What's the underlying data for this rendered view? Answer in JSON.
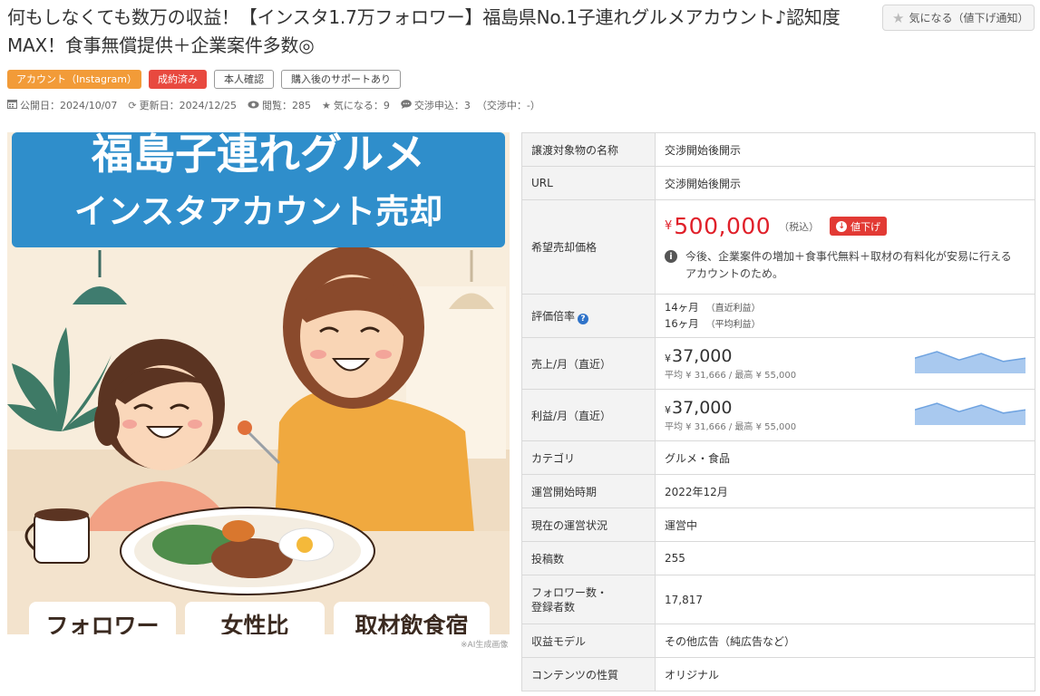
{
  "title": "何もしなくても数万の収益！【インスタ1.7万フォロワー】福島県No.1子連れグルメアカウント♪認知度MAX！食事無償提供＋企業案件多数◎",
  "favorite_button": {
    "label": "気になる（値下げ通知）",
    "icon": "star-icon"
  },
  "tags": {
    "category": "アカウント（Instagram）",
    "status": "成約済み",
    "verified": "本人確認",
    "support": "購入後のサポートあり"
  },
  "meta": {
    "published": "公開日：2024/10/07",
    "updated": "更新日：2024/12/25",
    "views": "閲覧：285",
    "favorites": "気になる：9",
    "negotiations": "交渉申込：3",
    "in_negotiation": "（交渉中：-）"
  },
  "hero": {
    "headline_line1": "福島子連れグルメ",
    "headline_line2": "インスタアカウント売却",
    "card1": "フォロワー",
    "card2": "女性比",
    "card3": "取材飲食宿",
    "ai_note": "※AI生成画像",
    "colors": {
      "banner": "#2f8ecb",
      "background": "#f7ecdc",
      "mother_shirt": "#f0a93f",
      "child_shirt": "#f2a184"
    }
  },
  "spec": {
    "target_name": {
      "key": "譲渡対象物の名称",
      "value": "交渉開始後開示"
    },
    "url": {
      "key": "URL",
      "value": "交渉開始後開示"
    },
    "price": {
      "key": "希望売却価格",
      "yen": "¥",
      "value": "500,000",
      "tax": "（税込）",
      "badge": "値下げ",
      "note": "今後、企業案件の増加＋食事代無料＋取材の有料化が安易に行えるアカウントのため。"
    },
    "multiple": {
      "key": "評価倍率",
      "recent_value": "14ヶ月",
      "recent_label": "（直近利益）",
      "avg_value": "16ヶ月",
      "avg_label": "（平均利益）"
    },
    "sales": {
      "key": "売上/月（直近）",
      "yen": "¥",
      "value": "37,000",
      "sub": "平均 ¥ 31,666 / 最高 ¥ 55,000",
      "trend": [
        37000,
        55000,
        32000,
        50000,
        28000,
        37000
      ]
    },
    "profit": {
      "key": "利益/月（直近）",
      "yen": "¥",
      "value": "37,000",
      "sub": "平均 ¥ 31,666 / 最高 ¥ 55,000",
      "trend": [
        37000,
        55000,
        32000,
        50000,
        28000,
        37000
      ]
    },
    "category": {
      "key": "カテゴリ",
      "value": "グルメ・食品"
    },
    "start": {
      "key": "運営開始時期",
      "value": "2022年12月"
    },
    "status": {
      "key": "現在の運営状況",
      "value": "運営中"
    },
    "posts": {
      "key": "投稿数",
      "value": "255"
    },
    "followers": {
      "key_line1": "フォロワー数・",
      "key_line2": "登録者数",
      "value": "17,817"
    },
    "revenue_model": {
      "key": "収益モデル",
      "value": "その他広告（純広告など）"
    },
    "content": {
      "key": "コンテンツの性質",
      "value": "オリジナル"
    }
  },
  "accent": {
    "red": "#e0202a",
    "orange": "#f29b38",
    "spark_fill": "#a9c9ef",
    "spark_line": "#6fa3e0"
  }
}
